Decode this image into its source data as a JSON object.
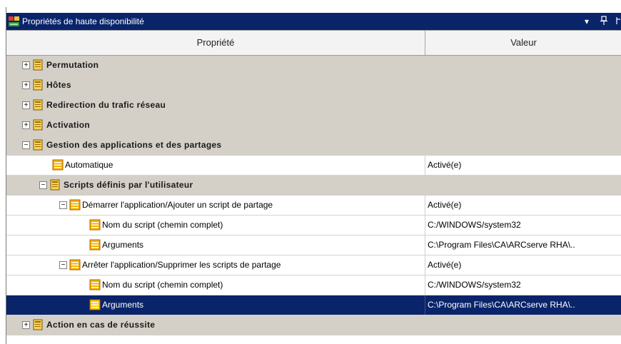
{
  "window": {
    "title": "Propriétés de haute disponibilité",
    "dropdown_glyph": "▾",
    "pin_glyph": "ᚲ",
    "close_glyph": "×"
  },
  "columns": {
    "property": "Propriété",
    "value": "Valeur"
  },
  "icons": {
    "group": "book-icon",
    "property": "property-icon",
    "expand": "plus-box-icon",
    "collapse": "minus-box-icon"
  },
  "colors": {
    "title_bar": "#0a246a",
    "category_row": "#d4d0c8",
    "selection": "#0a246a"
  },
  "rows": [
    {
      "label": "Permutation",
      "value": ""
    },
    {
      "label": "Hôtes",
      "value": ""
    },
    {
      "label": "Redirection du trafic réseau",
      "value": ""
    },
    {
      "label": "Activation",
      "value": ""
    },
    {
      "label": "Gestion des applications et des partages",
      "value": ""
    },
    {
      "label": "Automatique",
      "value": "Activé(e)"
    },
    {
      "label": "Scripts définis par l'utilisateur",
      "value": ""
    },
    {
      "label": "Démarrer l'application/Ajouter un script de partage",
      "value": "Activé(e)"
    },
    {
      "label": "Nom du script (chemin complet)",
      "value": "C:/WINDOWS/system32"
    },
    {
      "label": "Arguments",
      "value": "C:\\Program Files\\CA\\ARCserve RHA\\.."
    },
    {
      "label": "Arrêter l'application/Supprimer les scripts de partage",
      "value": "Activé(e)"
    },
    {
      "label": "Nom du script (chemin complet)",
      "value": "C:/WINDOWS/system32"
    },
    {
      "label": "Arguments",
      "value": "C:\\Program Files\\CA\\ARCserve RHA\\.."
    },
    {
      "label": "Action en cas de réussite",
      "value": ""
    }
  ]
}
